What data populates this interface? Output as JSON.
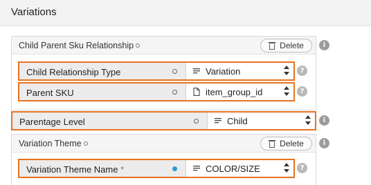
{
  "header": {
    "title": "Variations"
  },
  "child_parent_group": {
    "title": "Child Parent Sku Relationship",
    "delete_label": "Delete",
    "fields": [
      {
        "label": "Child Relationship Type",
        "value": "Variation",
        "icon": "list-icon"
      },
      {
        "label": "Parent SKU",
        "value": "item_group_id",
        "icon": "document-icon"
      }
    ]
  },
  "parentage": {
    "label": "Parentage Level",
    "value": "Child",
    "icon": "list-icon"
  },
  "variation_theme_group": {
    "title": "Variation Theme",
    "delete_label": "Delete",
    "fields": [
      {
        "label": "Variation Theme Name",
        "required_mark": "*",
        "value": "COLOR/SIZE",
        "icon": "list-icon"
      }
    ]
  },
  "colors": {
    "accent": "#e8711f",
    "dot_filled": "#2b9bd6"
  }
}
